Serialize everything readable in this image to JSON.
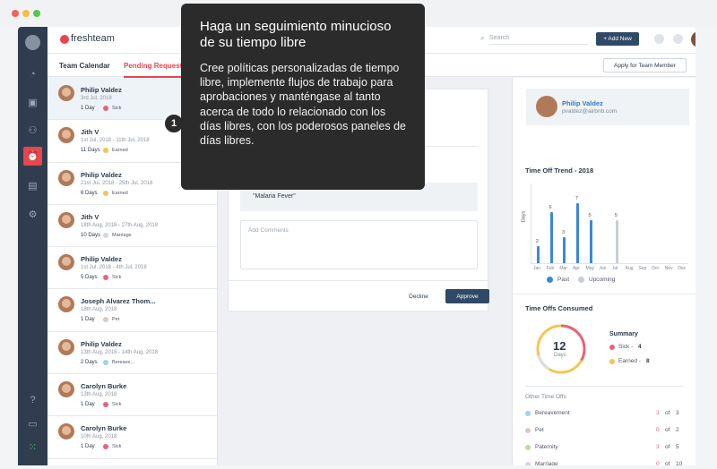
{
  "app": {
    "logo": "freshteam"
  },
  "header": {
    "search_placeholder": "Search",
    "new_button": "+ Add New"
  },
  "tabs": {
    "calendar": "Team Calendar",
    "pending": "Pending Requests",
    "apply": "Apply for Team Member"
  },
  "requests": [
    {
      "name": "Philip Valdez",
      "date": "3rd Jul, 2018",
      "days": "1 Day",
      "type": "Sick",
      "color": "#e8637a"
    },
    {
      "name": "Jith V",
      "date": "1st Jul, 2018 - 11th Jul, 2018",
      "days": "11 Days",
      "type": "Earned",
      "color": "#f3c64f"
    },
    {
      "name": "Philip Valdez",
      "date": "21st Jul, 2018 - 25th Jul, 2018",
      "days": "6 Days",
      "type": "Earned",
      "color": "#f3c64f"
    },
    {
      "name": "Jith V",
      "date": "18th Aug, 2018 - 27th Aug, 2018",
      "days": "10 Days",
      "type": "Marriage",
      "color": "#d8d3e5"
    },
    {
      "name": "Philip Valdez",
      "date": "1st Jul, 2018 - 4th Jul, 2018",
      "days": "5 Days",
      "type": "Sick",
      "color": "#e8637a"
    },
    {
      "name": "Joseph Alvarez Thom...",
      "date": "18th Aug, 2018",
      "days": "1 Day",
      "type": "Pet",
      "color": "#d9c9c6"
    },
    {
      "name": "Philip Valdez",
      "date": "13th Aug, 2018 - 14th Aug, 2018",
      "days": "2 Days",
      "type": "Bereave...",
      "color": "#9fd0ee"
    },
    {
      "name": "Carolyn Burke",
      "date": "13th Aug, 2018",
      "days": "1 Day",
      "type": "Sick",
      "color": "#e8637a"
    },
    {
      "name": "Carolyn Burke",
      "date": "10th Aug, 2018",
      "days": "1 Day",
      "type": "Sick",
      "color": "#e8637a"
    }
  ],
  "detail": {
    "reason": "\"Malaria Fever\"",
    "comments_placeholder": "Add Comments",
    "decline": "Decline",
    "approve": "Approve"
  },
  "profile": {
    "name": "Philip Valdez",
    "email": "pvaldez@airbnb.com"
  },
  "trend": {
    "title": "Time Off Trend - 2018",
    "ylabel": "Days",
    "months": [
      "Jan",
      "Feb",
      "Mar",
      "Apr",
      "May",
      "Jun",
      "Jul",
      "Aug",
      "Sep",
      "Oct",
      "Nov",
      "Dec"
    ],
    "labels": [
      "2",
      "6",
      "3",
      "7",
      "5",
      "",
      "5",
      "",
      "",
      "",
      "",
      ""
    ],
    "legend_past": "Past",
    "legend_upcoming": "Upcoming"
  },
  "chart_data": {
    "type": "bar",
    "title": "Time Off Trend - 2018",
    "ylabel": "Days",
    "categories": [
      "Jan",
      "Feb",
      "Mar",
      "Apr",
      "May",
      "Jun",
      "Jul",
      "Aug",
      "Sep",
      "Oct",
      "Nov",
      "Dec"
    ],
    "series": [
      {
        "name": "Past",
        "values": [
          2,
          6,
          3,
          7,
          5,
          0,
          0,
          0,
          0,
          0,
          0,
          0
        ]
      },
      {
        "name": "Upcoming",
        "values": [
          0,
          0,
          0,
          0,
          0,
          0,
          5,
          0,
          0,
          0,
          0,
          0
        ]
      }
    ]
  },
  "consumed": {
    "title": "Time Offs Consumed",
    "total": "12",
    "unit": "Days",
    "summary_title": "Summary",
    "sick_label": "Sick -",
    "sick_value": "4",
    "earned_label": "Earned -",
    "earned_value": "8"
  },
  "other": {
    "title": "Other Time Offs",
    "items": [
      {
        "label": "Bereavement",
        "used": "3",
        "of": "of",
        "total": "3",
        "color": "#9fd0ee"
      },
      {
        "label": "Pet",
        "used": "0",
        "of": "of",
        "total": "2",
        "color": "#d9c9c6"
      },
      {
        "label": "Paternity",
        "used": "3",
        "of": "of",
        "total": "5",
        "color": "#b7e0a2"
      },
      {
        "label": "Marriage",
        "used": "0",
        "of": "of",
        "total": "10",
        "color": "#d8d3e5"
      }
    ]
  },
  "tooltip": {
    "step": "1",
    "title": "Haga un seguimiento minucioso de su tiempo libre",
    "body": "Cree políticas personalizadas de tiempo libre, implemente flujos de trabajo para aprobaciones y manténgase al tanto acerca de todo lo relacionado con los días libres, con los poderosos paneles de días libres."
  }
}
